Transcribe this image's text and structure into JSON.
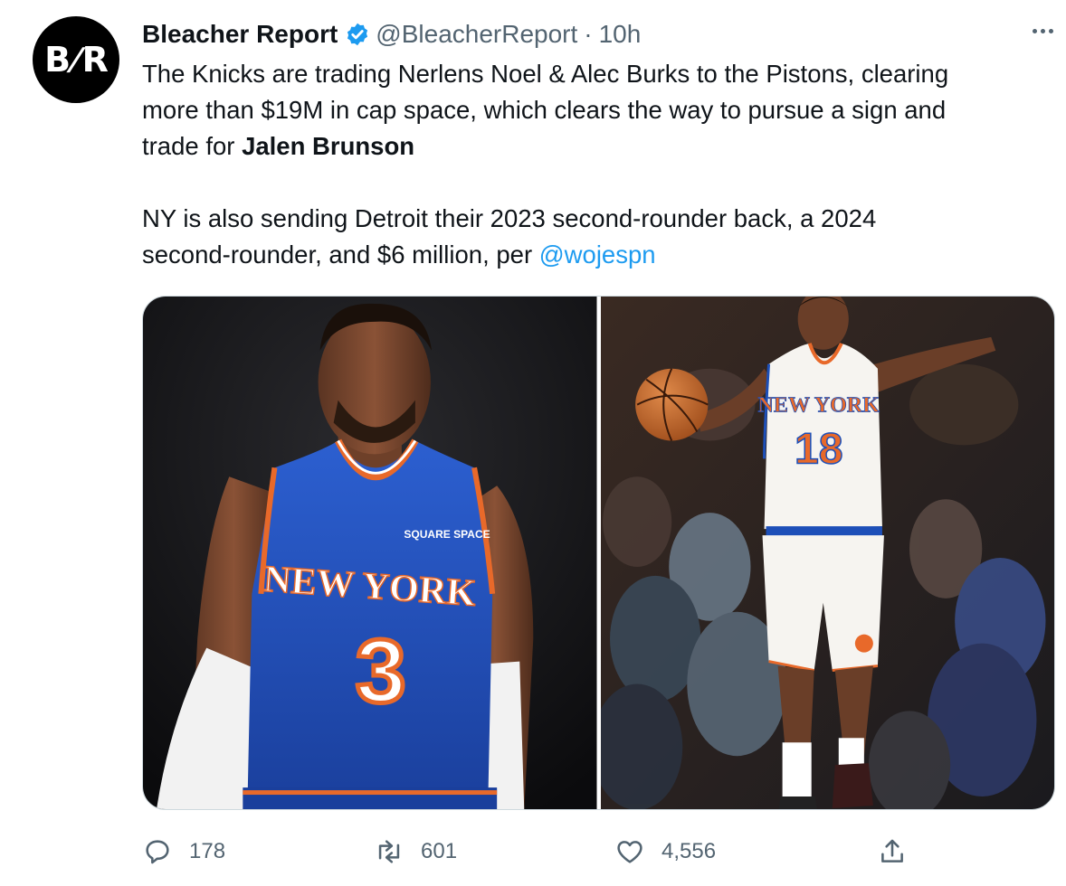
{
  "account": {
    "avatar_text_left": "B",
    "avatar_text_slash": "/",
    "avatar_text_right": "R",
    "display_name": "Bleacher Report",
    "verified": true,
    "handle": "@BleacherReport",
    "separator": "·",
    "time": "10h"
  },
  "tweet": {
    "line1": "The Knicks are trading Nerlens Noel & Alec Burks to the Pistons, clearing",
    "line2": "more than $19M in cap space, which clears the way to pursue a sign and",
    "line3_prefix": "trade for ",
    "line3_bold": "Jalen Brunson",
    "line4": "NY is also sending Detroit their 2023 second-rounder back, a 2024",
    "line5_prefix": "second-rounder, and $6 million, per ",
    "mention": "@wojespn"
  },
  "media": {
    "left_jersey_text": "NEW YORK",
    "left_jersey_number": "3",
    "left_jersey_sponsor": "SQUARE SPACE",
    "right_jersey_text": "NEW YORK",
    "right_jersey_number": "18"
  },
  "actions": {
    "replies": "178",
    "retweets": "601",
    "likes": "4,556"
  },
  "colors": {
    "accent": "#1d9bf0",
    "secondary_text": "#536471",
    "knicks_blue": "#1d4fb8",
    "knicks_orange": "#e8692a"
  },
  "icons": {
    "reply": "reply-icon",
    "retweet": "retweet-icon",
    "like": "heart-icon",
    "share": "share-icon",
    "more": "more-icon",
    "verified": "verified-badge-icon"
  }
}
